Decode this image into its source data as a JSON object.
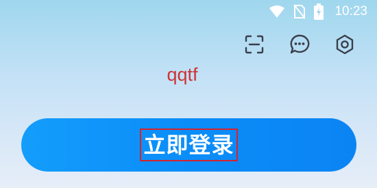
{
  "status_bar": {
    "time": "10:23",
    "icons": [
      "wifi-icon",
      "no-sim-icon",
      "battery-charging-icon"
    ]
  },
  "top_actions": {
    "icons": [
      "scan-icon",
      "message-icon",
      "settings-icon"
    ]
  },
  "account": {
    "username": "qqtf"
  },
  "login_button": {
    "label": "立即登录"
  },
  "colors": {
    "background_top": "#9fd7ee",
    "background_bottom": "#e6eef8",
    "button": "#0b8df8",
    "username": "#cc3434",
    "highlight_border": "#d7232b",
    "icon": "#3a3f4b"
  }
}
